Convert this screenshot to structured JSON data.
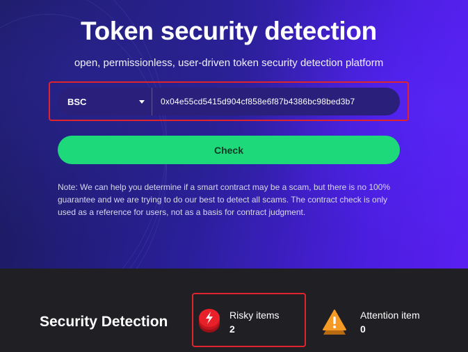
{
  "hero": {
    "title": "Token security detection",
    "subtitle": "open, permissionless, user-driven token security detection platform"
  },
  "search": {
    "chain": "BSC",
    "address": "0x04e55cd5415d904cf858e6f87b4386bc98bed3b7"
  },
  "check_button": {
    "label": "Check"
  },
  "note": {
    "text": "Note: We can help you determine if a smart contract may be a scam, but there is no 100% guarantee and we are trying to do our best to detect all scams. The contract check is only used as a reference for users, not as a basis for contract judgment."
  },
  "security": {
    "title": "Security Detection",
    "risky": {
      "label": "Risky items",
      "count": "2",
      "icon": "lightning-icon"
    },
    "attention": {
      "label": "Attention item",
      "count": "0",
      "icon": "warning-icon"
    }
  },
  "colors": {
    "accent_green": "#1ed97a",
    "highlight_red": "#e0242e",
    "risk_red": "#e8202a",
    "warning_orange": "#f59a24"
  }
}
